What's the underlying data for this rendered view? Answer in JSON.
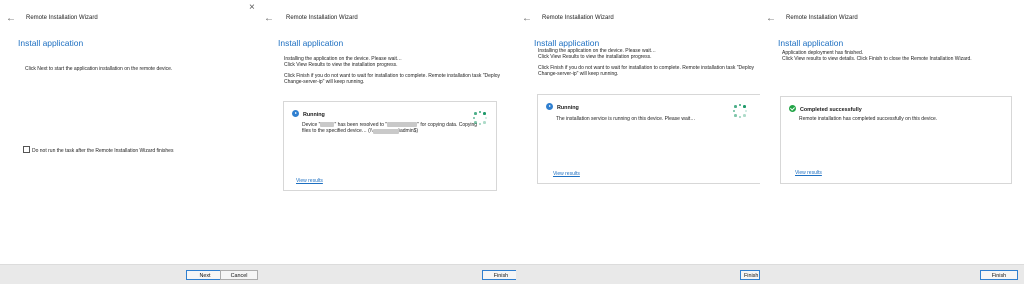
{
  "wizard_title": "Remote Installation Wizard",
  "heading": "Install application",
  "close_glyph": "×",
  "back_glyph": "←",
  "panel1": {
    "instruction": "Click Next to start the application installation on the remote device.",
    "checkbox_label": "Do not run the task after the Remote Installation Wizard finishes",
    "buttons": {
      "next": "Next",
      "cancel": "Cancel"
    }
  },
  "panel2": {
    "lines": [
      "Installing the application on the device. Please wait…",
      "Click View Results to view the installation progress.",
      "",
      "Click Finish if you do not want to wait for installation to complete. Remote installation task \"Deploy",
      "Change-server-ip\" will keep running."
    ],
    "status": "Running",
    "message_a1": "Device \"",
    "redact_1": "████",
    "message_a2": "\" has been resolved to \"",
    "redact_2": "██████████",
    "message_a3": "\" for copying data. Copying",
    "message_b1": "files to the specified device… (\\\\",
    "redact_3": "█████████",
    "message_b2": "\\admin$)",
    "view_results": "View results",
    "finish": "Finish"
  },
  "panel3": {
    "lines": [
      "Installing the application on the device. Please wait…",
      "Click View Results to view the installation progress.",
      "",
      "Click Finish if you do not want to wait for installation to complete. Remote installation task \"Deploy",
      "Change-server-ip\" will keep running."
    ],
    "status": "Running",
    "message": "The installation service is running on this device. Please wait…",
    "view_results": "View results",
    "finish": "Finish"
  },
  "panel4": {
    "lines": [
      "Application deployment has finished.",
      "Click View results to view details. Click Finish to close the Remote Installation Wizard."
    ],
    "status": "Completed successfully",
    "message": "Remote installation has completed successfully on this device.",
    "view_results": "View results",
    "finish": "Finish"
  },
  "colors": {
    "accent": "#1d6fc1",
    "running": "#2f7fd0",
    "success": "#22a447",
    "spinner": "#1f9a6a"
  },
  "icons": [
    "back-arrow-icon",
    "close-icon",
    "running-status-icon",
    "success-status-icon",
    "loading-spinner-icon"
  ]
}
